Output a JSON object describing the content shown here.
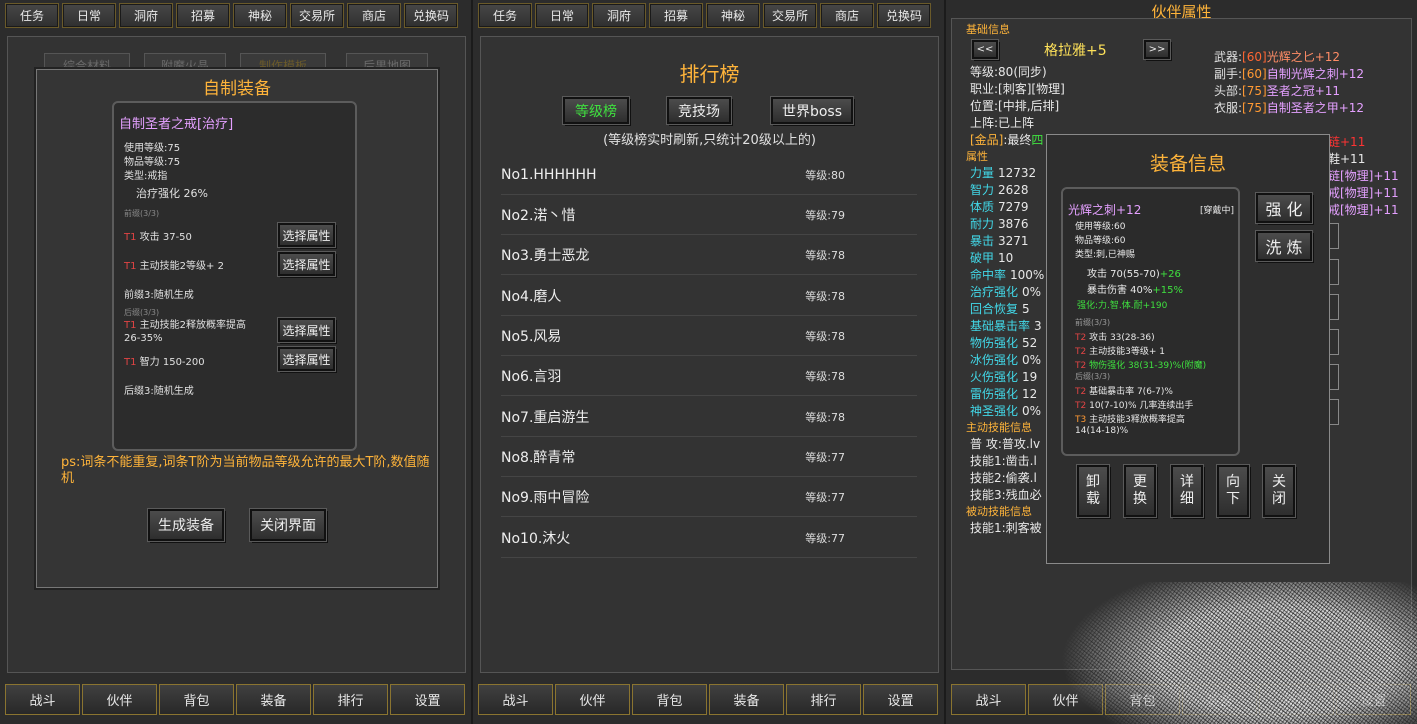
{
  "tabs": [
    "任务",
    "日常",
    "洞府",
    "招募",
    "神秘",
    "交易所",
    "商店",
    "兑换码"
  ],
  "bottom_nav": [
    "战斗",
    "伙伴",
    "背包",
    "装备",
    "排行",
    "设置"
  ],
  "panel1": {
    "ghost_tabs": [
      "综合材料",
      "附魔火晶",
      "制作模板",
      "后果地图"
    ],
    "modal_title": "自制装备",
    "item": {
      "name": "自制圣者之戒[治疗]",
      "use_level": "使用等级:75",
      "item_level": "物品等级:75",
      "type": "类型:戒指",
      "base_attr": "治疗强化 26%",
      "prefix_header": "前缀(3/3)",
      "prefix": [
        {
          "tier": "T1",
          "text": " 攻击 37-50",
          "button": "选择属性"
        },
        {
          "tier": "T1",
          "text": " 主动技能2等级+ 2",
          "button": "选择属性"
        }
      ],
      "prefix3": "前缀3:随机生成",
      "suffix_header": "后缀(3/3)",
      "suffix": [
        {
          "tier": "T1",
          "text": " 主动技能2释放概率提高",
          "text2": "26-35%",
          "button": "选择属性"
        },
        {
          "tier": "T1",
          "text": " 智力 150-200",
          "button": "选择属性"
        }
      ],
      "suffix3": "后缀3:随机生成"
    },
    "ps_text": "ps:词条不能重复,词条T阶为当前物品等级允许的最大T阶,数值随机",
    "generate_btn": "生成装备",
    "close_btn": "关闭界面"
  },
  "panel2": {
    "title": "排行榜",
    "rank_tabs": [
      "等级榜",
      "竞技场",
      "世界boss"
    ],
    "note": "(等级榜实时刷新,只统计20级以上的)",
    "rows": [
      {
        "name": "No1.HHHHHH",
        "level": "等级:80"
      },
      {
        "name": "No2.渃丶惜",
        "level": "等级:79"
      },
      {
        "name": "No3.勇士恶龙",
        "level": "等级:78"
      },
      {
        "name": "No4.磨人",
        "level": "等级:78"
      },
      {
        "name": "No5.风易",
        "level": "等级:78"
      },
      {
        "name": "No6.言羽",
        "level": "等级:78"
      },
      {
        "name": "No7.重启游生",
        "level": "等级:78"
      },
      {
        "name": "No8.醉青常",
        "level": "等级:77"
      },
      {
        "name": "No9.雨中冒险",
        "level": "等级:77"
      },
      {
        "name": "No10.沐火",
        "level": "等级:77"
      }
    ]
  },
  "panel3": {
    "title": "伙伴属性",
    "basic_section": "基础信息",
    "prev": "<<",
    "next": ">>",
    "char_name": "格拉雅+5",
    "info": [
      "等级:80(同步)",
      "职业:[刺客][物理]",
      "位置:[中排,后排]",
      "上阵:已上阵"
    ],
    "gold_line": {
      "bracket": "[金品]",
      "rest": ":最终",
      "tail": "四"
    },
    "equipment": [
      {
        "slot": "武器:",
        "lvl": "[60]",
        "name": "光辉之匕+12",
        "lvl_color": "#ff6633"
      },
      {
        "slot": "副手:",
        "lvl": "[60]",
        "name": "自制光辉之刺+12",
        "lvl_color": "#ff9933"
      },
      {
        "slot": "头部:",
        "lvl": "[75]",
        "name": "圣者之冠+11",
        "lvl_color": "#ff9933"
      },
      {
        "slot": "衣服:",
        "lvl": "[75]",
        "name": "自制圣者之甲+12",
        "lvl_color": "#ff9933"
      }
    ],
    "equip_fragments": [
      {
        "text": "链+11",
        "color": "#ff3333"
      },
      {
        "text": "鞋+11",
        "color": "#e8e8e8"
      },
      {
        "text": "链[物理]+11",
        "color": "#e4a0ff"
      },
      {
        "text": "戒[物理]+11",
        "color": "#e4a0ff"
      },
      {
        "text": "戒[物理]+11",
        "color": "#e4a0ff"
      }
    ],
    "attr_section": "属性",
    "attributes": [
      {
        "k": "力量",
        "v": "12732"
      },
      {
        "k": "智力",
        "v": "2628"
      },
      {
        "k": "体质",
        "v": "7279"
      },
      {
        "k": "耐力",
        "v": "3876"
      },
      {
        "k": "暴击",
        "v": "3271"
      },
      {
        "k": "破甲",
        "v": "10"
      },
      {
        "k": "命中率",
        "v": "100%"
      },
      {
        "k": "治疗强化",
        "v": "0%"
      },
      {
        "k": "回合恢复",
        "v": "5"
      },
      {
        "k": "基础暴击率",
        "v": "3"
      },
      {
        "k": "物伤强化",
        "v": "52"
      },
      {
        "k": "冰伤强化",
        "v": "0%"
      },
      {
        "k": "火伤强化",
        "v": "19"
      },
      {
        "k": "雷伤强化",
        "v": "12"
      },
      {
        "k": "神圣强化",
        "v": "0%"
      }
    ],
    "active_section": "主动技能信息",
    "active_skills": [
      "普 攻:普攻.lv",
      "技能1:凿击.l",
      "技能2:偷袭.l",
      "技能3:残血必"
    ],
    "passive_section": "被动技能信息",
    "passive_skills": [
      "技能1:刺客被"
    ],
    "modal": {
      "title": "装备信息",
      "name": "光辉之刺+12",
      "worn": "[穿戴中]",
      "use_level": "使用等级:60",
      "item_level": "物品等级:60",
      "type": "类型:刺,已神赐",
      "attack": "攻击 70(55-70)",
      "attack_bonus": "+26",
      "crit": "暴击伤害 40%",
      "crit_bonus": "+15%",
      "enhance": "强化:力.智.体.耐+190",
      "prefix_header": "前缀(3/3)",
      "prefix": [
        {
          "tier": "T2",
          "text": " 攻击 33(28-36)",
          "green": false
        },
        {
          "tier": "T2",
          "text": " 主动技能3等级+ 1",
          "green": false
        },
        {
          "tier": "T2",
          "text": " 物伤强化 38(31-39)%(附魔)",
          "green": true
        }
      ],
      "suffix_header": "后缀(3/3)",
      "suffix": [
        {
          "tier": "T2",
          "text": " 基础暴击率 7(6-7)%",
          "tier_color": "t2"
        },
        {
          "tier": "T2",
          "text": " 10(7-10)% 几率连续出手",
          "tier_color": "t2"
        },
        {
          "tier": "T3",
          "text": " 主动技能3释放概率提高",
          "tier_color": "t3"
        }
      ],
      "suffix_last": "14(14-18)%",
      "side_btns": [
        "强 化",
        "洗 炼"
      ],
      "action_btns": [
        "卸\n载",
        "更\n换",
        "详\n细",
        "向\n下",
        "关\n闭"
      ]
    }
  }
}
